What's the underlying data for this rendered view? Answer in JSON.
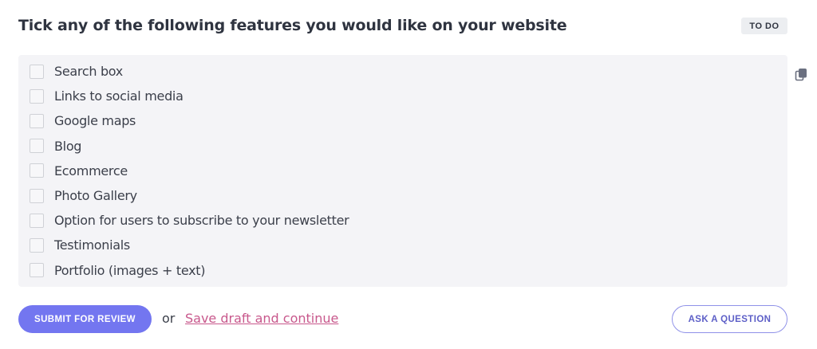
{
  "question": {
    "title": "Tick any of the following features you would like on your website",
    "status": "TO DO"
  },
  "options": [
    {
      "label": "Search box",
      "checked": false
    },
    {
      "label": "Links to social media",
      "checked": false
    },
    {
      "label": "Google maps",
      "checked": false
    },
    {
      "label": "Blog",
      "checked": false
    },
    {
      "label": "Ecommerce",
      "checked": false
    },
    {
      "label": "Photo Gallery",
      "checked": false
    },
    {
      "label": "Option for users to subscribe to your newsletter",
      "checked": false
    },
    {
      "label": "Testimonials",
      "checked": false
    },
    {
      "label": "Portfolio (images + text)",
      "checked": false
    }
  ],
  "actions": {
    "submit_label": "SUBMIT FOR REVIEW",
    "or_text": "or",
    "draft_label": "Save draft and continue",
    "ask_label": "ASK A QUESTION"
  },
  "icons": {
    "copy": "copy-icon"
  },
  "colors": {
    "accent": "#7376f0",
    "link": "#c8588c",
    "panel_bg": "#f4f4f7",
    "badge_bg": "#eceef1"
  }
}
